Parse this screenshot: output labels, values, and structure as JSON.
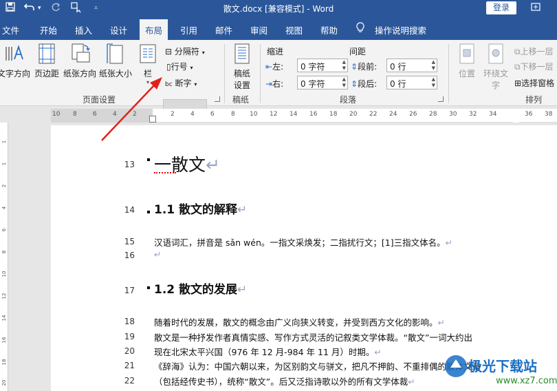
{
  "title_bar": {
    "doc_title": "散文.docx [兼容模式] - Word",
    "login_label": "登录",
    "save_icon": "save-icon",
    "undo_icon": "undo-icon",
    "redo_icon": "redo-icon",
    "touch_icon": "touch-mode-icon",
    "customize_icon": "customize-icon"
  },
  "tabs": [
    "文件",
    "开始",
    "插入",
    "设计",
    "布局",
    "引用",
    "邮件",
    "审阅",
    "视图",
    "帮助"
  ],
  "active_tab": "布局",
  "tell_me": "操作说明搜索",
  "ribbon": {
    "page_setup": {
      "text_direction": "文字方向",
      "margins": "页边距",
      "orientation": "纸张方向",
      "size": "纸张大小",
      "columns": "栏",
      "breaks": "分隔符",
      "line_numbers": "行号",
      "hyphenation": "断字",
      "group_label": "页面设置"
    },
    "draft_paper": {
      "button": "稿纸\n设置",
      "btn_line1": "稿纸",
      "btn_line2": "设置",
      "group_label": "稿纸"
    },
    "paragraph": {
      "indent_label": "缩进",
      "spacing_label": "间距",
      "left_label": "左:",
      "right_label": "右:",
      "before_label": "段前:",
      "after_label": "段后:",
      "left_value": "0 字符",
      "right_value": "0 字符",
      "before_value": "0 行",
      "after_value": "0 行",
      "group_label": "段落"
    },
    "arrange": {
      "position": "位置",
      "wrap_text_1": "环绕文",
      "wrap_text_2": "字",
      "bring_forward": "上移一层",
      "send_backward": "下移一层",
      "selection_pane": "选择窗格",
      "group_label": "排列"
    }
  },
  "ruler_labels": [
    "10",
    "8",
    "6",
    "4",
    "2",
    "2",
    "4",
    "6",
    "8",
    "10",
    "12",
    "14",
    "16",
    "18",
    "20",
    "22",
    "24",
    "26",
    "28",
    "30",
    "32",
    "34",
    "36",
    "38"
  ],
  "vruler_labels": [
    "1",
    "1",
    "2",
    "4",
    "6",
    "8",
    "10",
    "12",
    "14",
    "16",
    "18",
    "20"
  ],
  "document": {
    "lines": [
      {
        "num": "13",
        "text": "一散文",
        "style": "h1"
      },
      {
        "num": "14",
        "text": "1.1 散文的解释",
        "style": "h2"
      },
      {
        "num": "15",
        "text": "汉语词汇，拼音是 sǎn wén。一指文采焕发；二指扰行文；[1]三指文体名。",
        "style": "body"
      },
      {
        "num": "16",
        "text": "",
        "style": "body"
      },
      {
        "num": "17",
        "text": "1.2 散文的发展",
        "style": "h2"
      },
      {
        "num": "18",
        "text": "随着时代的发展，散文的概念由广义向狭义转变，并受到西方文化的影响。",
        "style": "body"
      },
      {
        "num": "19",
        "text": "散文是一种抒发作者真情实感、写作方式灵活的记叙类文学体裁。“散文”一词大约出",
        "style": "body"
      },
      {
        "num": "20",
        "text": "现在北宋太平兴国（976 年 12 月-984 年 11 月）时期。",
        "style": "body"
      },
      {
        "num": "21",
        "text": "《辞海》认为：中国六朝以来，为区别韵文与骈文，把凡不押韵、不重排偶的散体文章",
        "style": "body"
      },
      {
        "num": "22",
        "text": "（包括经传史书），统称“散文”。后又泛指诗歌以外的所有文学体裁",
        "style": "body"
      }
    ],
    "para_mark": "↵"
  },
  "watermark": {
    "text": "极光下载站",
    "url": "www.xz7.com"
  },
  "colors": {
    "accent": "#2b579a",
    "arrow": "#e0201b"
  }
}
